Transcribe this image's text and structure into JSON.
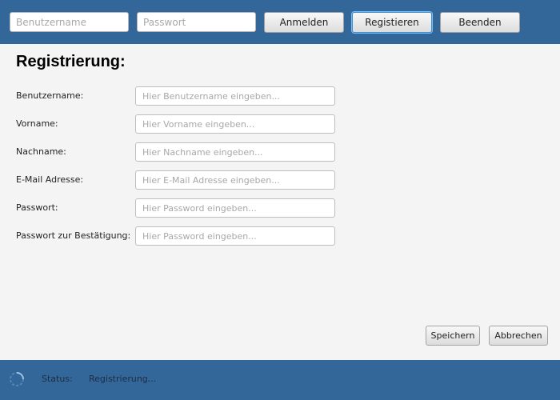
{
  "toolbar": {
    "username_placeholder": "Benutzername",
    "password_placeholder": "Passwort",
    "login_label": "Anmelden",
    "register_label": "Registieren",
    "quit_label": "Beenden"
  },
  "form": {
    "title": "Registrierung:",
    "fields": [
      {
        "label": "Benutzername:",
        "placeholder": "Hier Benutzername eingeben..."
      },
      {
        "label": "Vorname:",
        "placeholder": "Hier Vorname eingeben..."
      },
      {
        "label": "Nachname:",
        "placeholder": "Hier Nachname eingeben..."
      },
      {
        "label": "E-Mail Adresse:",
        "placeholder": "Hier E-Mail Adresse eingeben..."
      },
      {
        "label": "Passwort:",
        "placeholder": "Hier Password eingeben..."
      },
      {
        "label": "Passwort zur Bestätigung:",
        "placeholder": "Hier Password eingeben..."
      }
    ],
    "save_label": "Speichern",
    "cancel_label": "Abbrechen"
  },
  "status": {
    "label": "Status:",
    "text": "Registrierung...",
    "spinner_icon": "loading-spinner-icon"
  },
  "colors": {
    "bar_background": "#336699",
    "content_background": "#f4f4f4",
    "focus_ring": "#3a8fd8"
  }
}
